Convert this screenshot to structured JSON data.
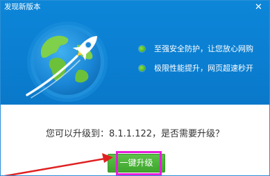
{
  "window": {
    "title": "发现新版本",
    "close_glyph": "✕"
  },
  "features": [
    {
      "label": "至强安全防护，让您放心网购"
    },
    {
      "label": "极限性能提升，网页超速秒开"
    }
  ],
  "prompt": {
    "text": "您可以升级到：8.1.1.122，是否需要升级？"
  },
  "actions": {
    "upgrade_label": "一键升级"
  },
  "colors": {
    "hero_blue": "#0b7fd2",
    "button_green": "#3ea52d",
    "highlight_magenta": "#e61ed9",
    "arrow_red": "#e02020"
  },
  "icons": {
    "globe": "globe-rocket-illustration",
    "bullet": "green-dot"
  }
}
